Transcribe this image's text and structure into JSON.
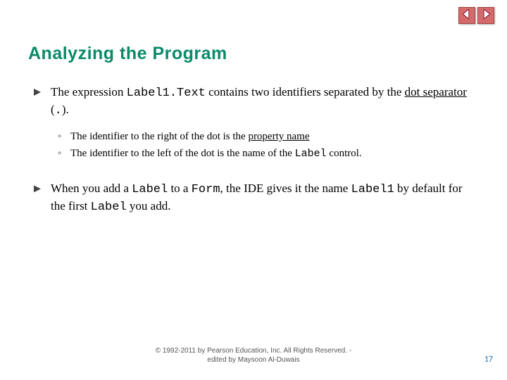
{
  "nav": {
    "back_icon": "arrow-left",
    "forward_icon": "arrow-right"
  },
  "title": "Analyzing the Program",
  "bullets": {
    "b1": {
      "pre": "The expression ",
      "code": "Label1.Text",
      "mid": " contains two identifiers separated by the ",
      "term": "dot separator",
      "post_open": " (",
      "dot": ".",
      "post_close": ")."
    },
    "sub": {
      "s1_pre": "The identifier to the right of the dot is the ",
      "s1_term": "property name",
      "s2_pre": "The identifier to the left of the dot is the name of the ",
      "s2_code": "Label",
      "s2_post": " control."
    },
    "b2": {
      "t1": "When you add a ",
      "c1": "Label",
      "t2": " to a ",
      "c2": "Form",
      "t3": ", the IDE gives it the name ",
      "c3": "Label1",
      "t4": " by default for the first ",
      "c4": "Label",
      "t5": " you add."
    }
  },
  "footer": {
    "line1": "© 1992-2011 by Pearson Education, Inc. All Rights Reserved. -",
    "line2": "edited by Maysoon Al-Duwais"
  },
  "page_number": "17"
}
